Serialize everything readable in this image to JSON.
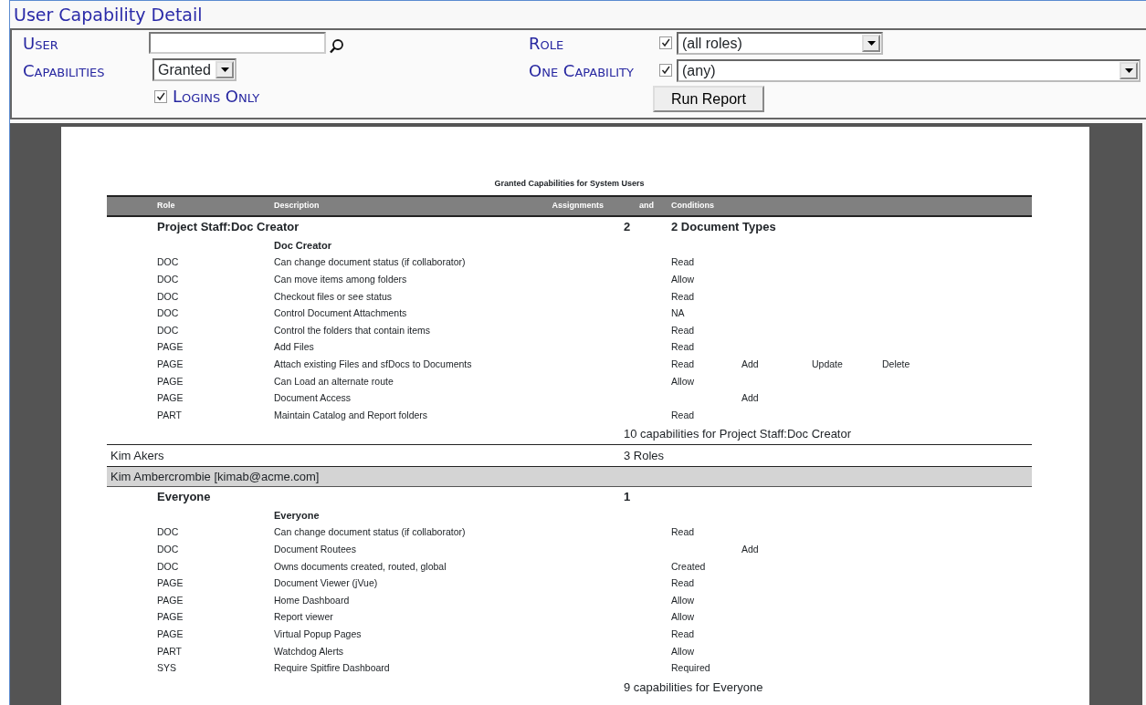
{
  "window": {
    "title": "User Capability Detail"
  },
  "form": {
    "user": {
      "label": "User"
    },
    "capabilities": {
      "label": "Capabilities",
      "value": "Granted"
    },
    "logins_only": {
      "label": "Logins Only",
      "checked": true
    },
    "role": {
      "label": "Role",
      "checked": true,
      "value": "(all roles)"
    },
    "one_capability": {
      "label": "One Capability",
      "checked": true,
      "value": "(any)"
    },
    "run_button": "Run Report"
  },
  "report": {
    "title": "Granted Capabilities for System Users",
    "columns": [
      "Role",
      "Description",
      "Assignments",
      "and",
      "Conditions"
    ],
    "rows": [
      {
        "kind": "role",
        "name": "Project Staff:Doc Creator",
        "count": "2",
        "conditions": "2 Document Types"
      },
      {
        "kind": "heading",
        "text": "Doc Creator"
      },
      {
        "kind": "capability",
        "type": "DOC",
        "description": "Can change document status (if collaborator)",
        "condition_1": "Read"
      },
      {
        "kind": "capability",
        "type": "DOC",
        "description": "Can move items among folders",
        "condition_1": "Allow"
      },
      {
        "kind": "capability",
        "type": "DOC",
        "description": "Checkout files or see status",
        "condition_1": "Read"
      },
      {
        "kind": "capability",
        "type": "DOC",
        "description": "Control Document Attachments",
        "condition_1": "NA"
      },
      {
        "kind": "capability",
        "type": "DOC",
        "description": "Control the folders that contain items",
        "condition_1": "Read"
      },
      {
        "kind": "capability",
        "type": "PAGE",
        "description": "Add Files",
        "condition_1": "Read"
      },
      {
        "kind": "capability",
        "type": "PAGE",
        "description": "Attach existing Files and sfDocs to Documents",
        "condition_1": "Read",
        "condition_2": "Add",
        "condition_3": "Update",
        "condition_4": "Delete"
      },
      {
        "kind": "capability",
        "type": "PAGE",
        "description": "Can Load an alternate route",
        "condition_1": "Allow"
      },
      {
        "kind": "capability",
        "type": "PAGE",
        "description": "Document Access",
        "condition_2": "Add"
      },
      {
        "kind": "capability",
        "type": "PART",
        "description": "Maintain Catalog and Report folders",
        "condition_1": "Read"
      },
      {
        "kind": "summary",
        "text": "10 capabilities for Project Staff:Doc Creator"
      },
      {
        "kind": "user",
        "name": "Kim Akers",
        "count": "3 Roles",
        "shaded": false
      },
      {
        "kind": "user",
        "name": "Kim Ambercrombie [kimab@acme.com]",
        "shaded": true
      },
      {
        "kind": "role",
        "name": "Everyone",
        "count": "1"
      },
      {
        "kind": "heading",
        "text": "Everyone"
      },
      {
        "kind": "capability",
        "type": "DOC",
        "description": "Can change document status (if collaborator)",
        "condition_1": "Read"
      },
      {
        "kind": "capability",
        "type": "DOC",
        "description": "Document Routees",
        "condition_2": "Add"
      },
      {
        "kind": "capability",
        "type": "DOC",
        "description": "Owns documents created, routed, global",
        "condition_1": "Created"
      },
      {
        "kind": "capability",
        "type": "PAGE",
        "description": "Document Viewer (jVue)",
        "condition_1": "Read"
      },
      {
        "kind": "capability",
        "type": "PAGE",
        "description": "Home Dashboard",
        "condition_1": "Allow"
      },
      {
        "kind": "capability",
        "type": "PAGE",
        "description": "Report viewer",
        "condition_1": "Allow"
      },
      {
        "kind": "capability",
        "type": "PAGE",
        "description": "Virtual Popup Pages",
        "condition_1": "Read"
      },
      {
        "kind": "capability",
        "type": "PART",
        "description": "Watchdog Alerts",
        "condition_1": "Allow"
      },
      {
        "kind": "capability",
        "type": "SYS",
        "description": "Require Spitfire Dashboard",
        "condition_1": "Required"
      },
      {
        "kind": "summary",
        "text": "9 capabilities for Everyone"
      }
    ]
  }
}
